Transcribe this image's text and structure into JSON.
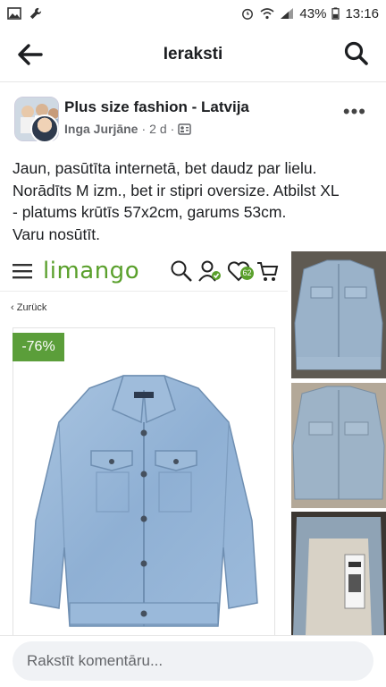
{
  "status_bar": {
    "time": "13:16",
    "battery": "43%",
    "icons": [
      "image-icon",
      "wrench-icon",
      "alarm-icon",
      "wifi-icon",
      "signal-icon",
      "battery-icon"
    ]
  },
  "app_bar": {
    "title": "Ieraksti",
    "back_icon": "arrow-left-icon",
    "search_icon": "search-icon"
  },
  "post": {
    "group_name": "Plus size fashion - Latvija",
    "author": "Inga Jurjāne",
    "time": "2 d",
    "separator": "·",
    "privacy_icon": "group-privacy-icon",
    "more_label": "•••",
    "text_lines": [
      "Jaun, pasūtīta internetā, bet daudz par lielu.",
      "Norādīts M izm., bet ir stipri oversize. Atbilst XL",
      "- platums krūtīs 57x2cm, garums 53cm.",
      "Varu nosūtīt."
    ]
  },
  "media": {
    "store_logo": "limango",
    "cart_badge": "62",
    "back_link": "‹ Zurück",
    "discount": "-76%",
    "thumbnails": [
      "jacket-front-photo",
      "jacket-front-photo-2",
      "jacket-label-photo"
    ]
  },
  "comment": {
    "placeholder": "Rakstīt komentāru..."
  },
  "colors": {
    "accent_green": "#5b9e3a",
    "text": "#1c1e21",
    "muted": "#65676b",
    "input_bg": "#f0f2f5"
  }
}
